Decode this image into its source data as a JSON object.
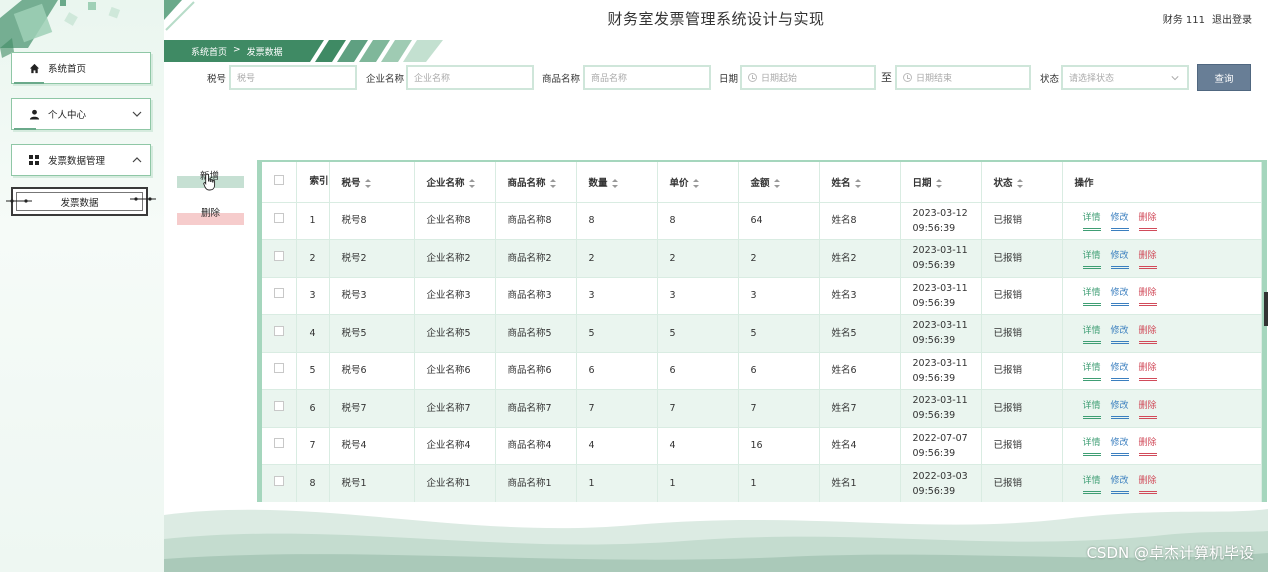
{
  "header": {
    "title": "财务室发票管理系统设计与实现",
    "user_name": "财务 111",
    "logout": "退出登录"
  },
  "breadcrumb": {
    "home": "系统首页",
    "separator": ">",
    "current": "发票数据"
  },
  "sidebar": {
    "items": [
      {
        "label": "系统首页",
        "icon": "home-icon"
      },
      {
        "label": "个人中心",
        "icon": "user-icon"
      },
      {
        "label": "发票数据管理",
        "icon": "grid-icon"
      }
    ],
    "sub_item": "发票数据"
  },
  "search": {
    "tax_label": "税号",
    "tax_placeholder": "税号",
    "company_label": "企业名称",
    "company_placeholder": "企业名称",
    "product_label": "商品名称",
    "product_placeholder": "商品名称",
    "date_label": "日期",
    "date_start_placeholder": "日期起始",
    "date_to": "至",
    "date_end_placeholder": "日期结束",
    "status_label": "状态",
    "status_placeholder": "请选择状态",
    "query_button": "查询"
  },
  "actions": {
    "add": "新增",
    "delete": "删除"
  },
  "table": {
    "headers": {
      "index": "索引",
      "tax": "税号",
      "company": "企业名称",
      "product": "商品名称",
      "qty": "数量",
      "price": "单价",
      "amount": "金额",
      "name": "姓名",
      "date": "日期",
      "status": "状态",
      "ops": "操作"
    },
    "op_labels": {
      "detail": "详情",
      "edit": "修改",
      "remove": "删除"
    },
    "rows": [
      {
        "index": "1",
        "tax": "税号8",
        "company": "企业名称8",
        "product": "商品名称8",
        "qty": "8",
        "price": "8",
        "amount": "64",
        "name": "姓名8",
        "date": "2023-03-12",
        "time": "09:56:39",
        "status": "已报销"
      },
      {
        "index": "2",
        "tax": "税号2",
        "company": "企业名称2",
        "product": "商品名称2",
        "qty": "2",
        "price": "2",
        "amount": "2",
        "name": "姓名2",
        "date": "2023-03-11",
        "time": "09:56:39",
        "status": "已报销"
      },
      {
        "index": "3",
        "tax": "税号3",
        "company": "企业名称3",
        "product": "商品名称3",
        "qty": "3",
        "price": "3",
        "amount": "3",
        "name": "姓名3",
        "date": "2023-03-11",
        "time": "09:56:39",
        "status": "已报销"
      },
      {
        "index": "4",
        "tax": "税号5",
        "company": "企业名称5",
        "product": "商品名称5",
        "qty": "5",
        "price": "5",
        "amount": "5",
        "name": "姓名5",
        "date": "2023-03-11",
        "time": "09:56:39",
        "status": "已报销"
      },
      {
        "index": "5",
        "tax": "税号6",
        "company": "企业名称6",
        "product": "商品名称6",
        "qty": "6",
        "price": "6",
        "amount": "6",
        "name": "姓名6",
        "date": "2023-03-11",
        "time": "09:56:39",
        "status": "已报销"
      },
      {
        "index": "6",
        "tax": "税号7",
        "company": "企业名称7",
        "product": "商品名称7",
        "qty": "7",
        "price": "7",
        "amount": "7",
        "name": "姓名7",
        "date": "2023-03-11",
        "time": "09:56:39",
        "status": "已报销"
      },
      {
        "index": "7",
        "tax": "税号4",
        "company": "企业名称4",
        "product": "商品名称4",
        "qty": "4",
        "price": "4",
        "amount": "16",
        "name": "姓名4",
        "date": "2022-07-07",
        "time": "09:56:39",
        "status": "已报销"
      },
      {
        "index": "8",
        "tax": "税号1",
        "company": "企业名称1",
        "product": "商品名称1",
        "qty": "1",
        "price": "1",
        "amount": "1",
        "name": "姓名1",
        "date": "2022-03-03",
        "time": "09:56:39",
        "status": "已报销"
      }
    ]
  },
  "watermark": "CSDN @卓杰计算机毕设",
  "colors": {
    "accent": "#3f8a64",
    "query_button": "#687e96",
    "add_button": "#c6e0d3",
    "delete_button": "#f6cccc",
    "row_stripe": "#eaf5ef"
  }
}
